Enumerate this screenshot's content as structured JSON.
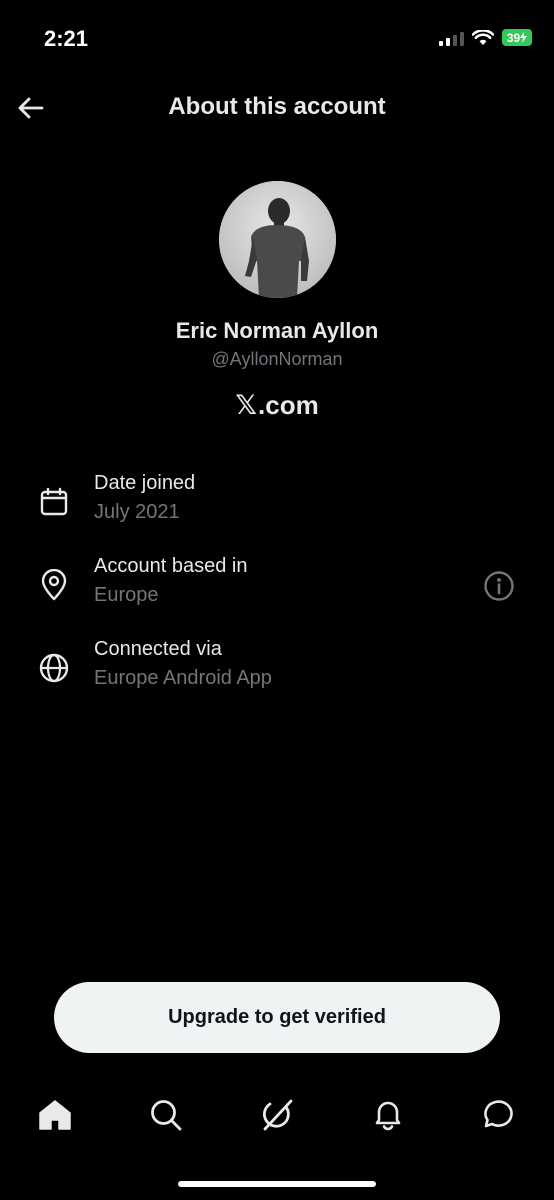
{
  "status_bar": {
    "time": "2:21",
    "battery": "39"
  },
  "header": {
    "title": "About this account",
    "back_icon": "arrow-left-icon"
  },
  "profile": {
    "display_name": "Eric Norman Ayllon",
    "handle": "@AyllonNorman",
    "site_logo": "𝕏",
    "site_text": ".com"
  },
  "info": [
    {
      "label": "Date joined",
      "value": "July 2021",
      "icon": "calendar-icon"
    },
    {
      "label": "Account based in",
      "value": "Europe",
      "icon": "location-pin-icon",
      "action_icon": "info-icon"
    },
    {
      "label": "Connected via",
      "value": "Europe Android App",
      "icon": "globe-icon"
    }
  ],
  "upgrade_button": {
    "label": "Upgrade to get verified"
  },
  "bottom_nav": [
    {
      "name": "home",
      "icon": "home-icon"
    },
    {
      "name": "search",
      "icon": "search-icon"
    },
    {
      "name": "grok",
      "icon": "grok-icon"
    },
    {
      "name": "notifications",
      "icon": "bell-icon"
    },
    {
      "name": "messages",
      "icon": "chat-bubble-icon"
    }
  ],
  "colors": {
    "background": "#000000",
    "primary_text": "#e7e9ea",
    "secondary_text": "#71767b",
    "button_bg": "#eff3f4",
    "battery": "#34c759"
  }
}
